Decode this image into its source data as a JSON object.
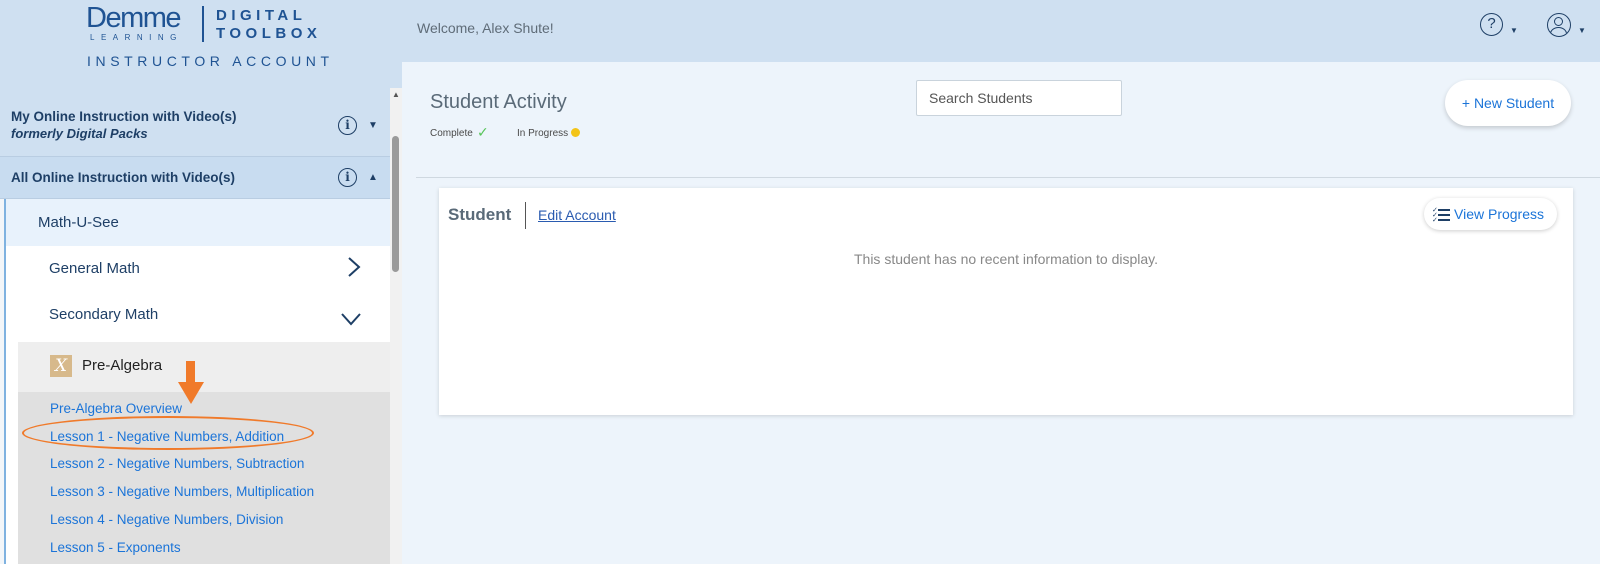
{
  "brand": {
    "demme": "Demme",
    "learning": "LEARNING",
    "product_line1": "DIGITAL",
    "product_line2": "TOOLBOX",
    "account_type": "INSTRUCTOR ACCOUNT"
  },
  "header": {
    "welcome": "Welcome, Alex Shute!",
    "help_icon": "help-circle-icon",
    "user_icon": "user-circle-icon"
  },
  "sidebar": {
    "sections": [
      {
        "title": "My Online Instruction with Video(s)",
        "subtitle": "formerly Digital Packs",
        "expanded": false
      },
      {
        "title": "All Online Instruction with Video(s)",
        "subtitle": "",
        "expanded": true
      }
    ],
    "program": "Math-U-See",
    "branches": [
      {
        "label": "General Math",
        "expanded": false
      },
      {
        "label": "Secondary Math",
        "expanded": true
      }
    ],
    "course": {
      "badge": "X",
      "label": "Pre-Algebra"
    },
    "lessons": [
      "Pre-Algebra Overview",
      "Lesson 1 - Negative Numbers, Addition",
      "Lesson 2 - Negative Numbers, Subtraction",
      "Lesson 3 - Negative Numbers, Multiplication",
      "Lesson 4 - Negative Numbers, Division",
      "Lesson 5 - Exponents"
    ]
  },
  "main": {
    "title": "Student Activity",
    "legend": {
      "complete": "Complete",
      "in_progress": "In Progress"
    },
    "search_placeholder": "Search Students",
    "new_student": "+ New Student",
    "card": {
      "student": "Student",
      "edit_account": "Edit Account",
      "view_progress": "View Progress",
      "empty_message": "This student has no recent information to display."
    }
  },
  "colors": {
    "accent": "#1b74d8",
    "nav_text": "#1e3f66",
    "annotation": "#f07a2a",
    "complete": "#57c45a",
    "in_progress": "#f3c418"
  }
}
